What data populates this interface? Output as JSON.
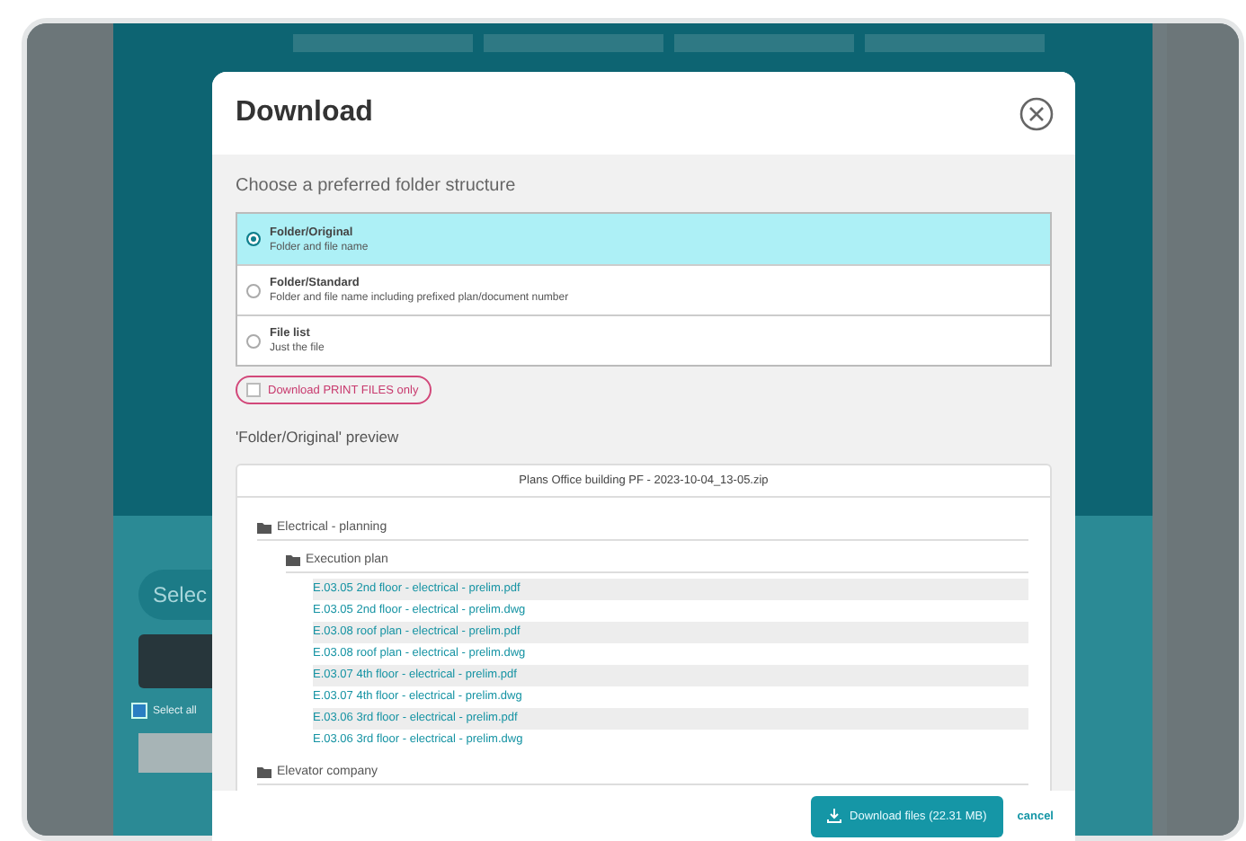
{
  "background": {
    "select_pill": "Selec",
    "select_all": {
      "label": "Select all",
      "checked": true
    }
  },
  "dialog": {
    "title": "Download",
    "prompt": "Choose a preferred folder structure",
    "options": [
      {
        "title": "Folder/Original",
        "description": "Folder and file name",
        "selected": true
      },
      {
        "title": "Folder/Standard",
        "description": "Folder and file name including prefixed plan/document number",
        "selected": false
      },
      {
        "title": "File list",
        "description": "Just the file",
        "selected": false
      }
    ],
    "print_only": {
      "label": "Download PRINT FILES only",
      "checked": false
    },
    "preview_title": "'Folder/Original' preview",
    "preview": {
      "archive": "Plans Office building PF - 2023-10-04_13-05.zip",
      "tree": [
        {
          "kind": "folder",
          "label": "Electrical - planning",
          "children": [
            {
              "kind": "folder",
              "label": "Execution plan",
              "children": [
                {
                  "kind": "file",
                  "label": "E.03.05 2nd floor - electrical - prelim.pdf"
                },
                {
                  "kind": "file",
                  "label": "E.03.05 2nd floor - electrical - prelim.dwg"
                },
                {
                  "kind": "file",
                  "label": "E.03.08 roof plan - electrical - prelim.pdf"
                },
                {
                  "kind": "file",
                  "label": "E.03.08 roof plan - electrical - prelim.dwg"
                },
                {
                  "kind": "file",
                  "label": "E.03.07 4th floor - electrical - prelim.pdf"
                },
                {
                  "kind": "file",
                  "label": "E.03.07 4th floor - electrical - prelim.dwg"
                },
                {
                  "kind": "file",
                  "label": "E.03.06 3rd floor - electrical - prelim.pdf"
                },
                {
                  "kind": "file",
                  "label": "E.03.06 3rd floor - electrical - prelim.dwg"
                }
              ]
            }
          ]
        },
        {
          "kind": "folder",
          "label": "Elevator company"
        }
      ]
    },
    "download_button": "Download files (22.31 MB)",
    "cancel": "cancel"
  }
}
